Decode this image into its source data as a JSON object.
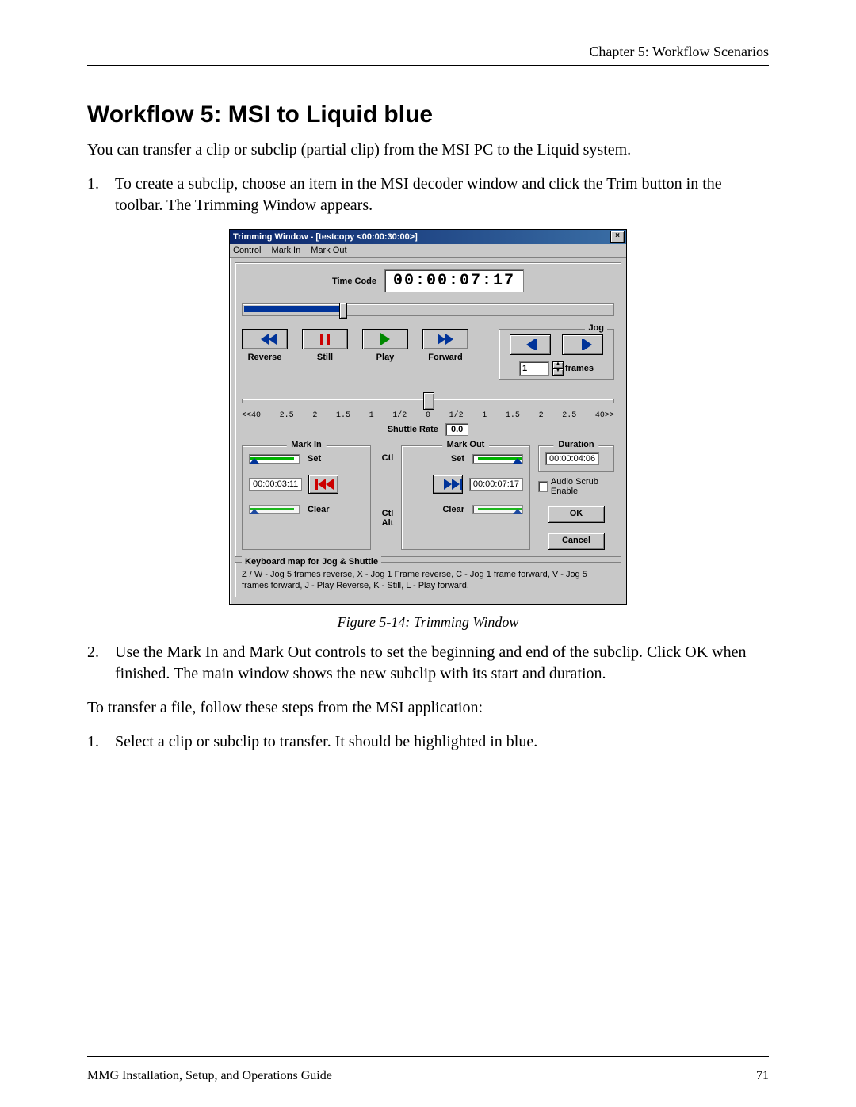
{
  "header": {
    "chapter": "Chapter 5: Workflow Scenarios"
  },
  "title": "Workflow 5: MSI to Liquid blue",
  "intro": "You can transfer a clip or subclip (partial clip) from the MSI PC to the Liquid system.",
  "step1": {
    "num": "1.",
    "text": "To create a subclip, choose an item in the MSI decoder window and click the Trim button in the toolbar. The Trimming Window appears."
  },
  "figure": {
    "caption": "Figure 5-14: Trimming Window"
  },
  "step2": {
    "num": "2.",
    "text": "Use the Mark In and Mark Out controls to set the beginning and end of the subclip. Click OK when finished. The main window shows the new subclip with its start and duration."
  },
  "para3": "To transfer a file, follow these steps from the MSI application:",
  "step3": {
    "num": "1.",
    "text": "Select a clip or subclip to transfer. It should be highlighted in blue."
  },
  "footer": {
    "left": "MMG Installation, Setup, and Operations Guide",
    "right": "71"
  },
  "win": {
    "title": "Trimming Window - [testcopy <00:00:30:00>]",
    "close": "×",
    "menu": {
      "control": "Control",
      "markin": "Mark In",
      "markout": "Mark Out"
    },
    "timecode_label": "Time Code",
    "timecode": "00:00:07:17",
    "reverse": "Reverse",
    "still": "Still",
    "play": "Play",
    "forward": "Forward",
    "jog": "Jog",
    "frames_value": "1",
    "frames_label": "frames",
    "ticks": {
      "a": "<<40",
      "b": "2.5",
      "c": "2",
      "d": "1.5",
      "e": "1",
      "f": "1/2",
      "g": "0",
      "h": "1/2",
      "i": "1",
      "j": "1.5",
      "k": "2",
      "l": "2.5",
      "m": "40>>"
    },
    "shuttle_label": "Shuttle Rate",
    "shuttle_value": "0.0",
    "markin_legend": "Mark In",
    "markout_legend": "Mark Out",
    "duration_legend": "Duration",
    "set": "Set",
    "clear": "Clear",
    "ctl": "Ctl",
    "ctl_alt": "Ctl Alt",
    "markin_tc": "00:00:03:11",
    "markout_tc": "00:00:07:17",
    "duration_tc": "00:00:04:06",
    "audio_scrub": "Audio Scrub Enable",
    "ok": "OK",
    "cancel": "Cancel",
    "kbmap_legend": "Keyboard map for Jog & Shuttle",
    "kbmap_text": "Z / W - Jog 5 frames reverse,  X - Jog 1 Frame reverse, C - Jog 1 frame forward, V - Jog 5 frames forward, J - Play Reverse, K - Still, L - Play forward."
  }
}
